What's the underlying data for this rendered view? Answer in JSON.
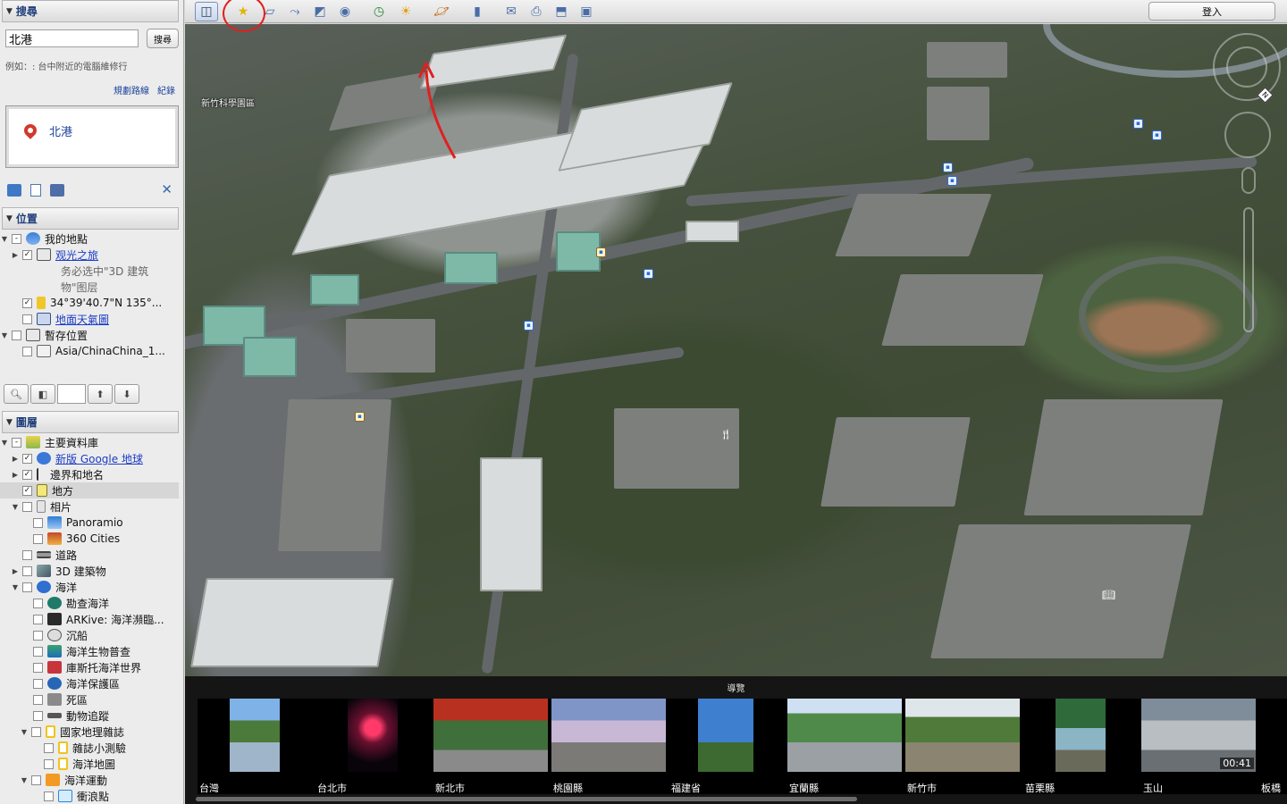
{
  "search": {
    "header": "搜尋",
    "query_value": "北港",
    "button_label": "搜尋",
    "example_text": "例如：: 台中附近的電腦維修行",
    "route_link": "規劃路線",
    "history_link": "紀錄",
    "result_label": "北港"
  },
  "places": {
    "header": "位置",
    "items": [
      {
        "label": "我的地點"
      },
      {
        "label": "观光之旅"
      },
      {
        "label": "务必选中\"3D 建筑"
      },
      {
        "label": "物\"图层"
      },
      {
        "label": "34°39'40.7\"N 135°..."
      },
      {
        "label": "地面天氣圖"
      },
      {
        "label": "暫存位置"
      },
      {
        "label": "Asia/ChinaChina_1..."
      }
    ]
  },
  "layers": {
    "header": "圖層",
    "items": [
      {
        "label": "主要資料庫"
      },
      {
        "label": "新版 Google 地球"
      },
      {
        "label": "邊界和地名"
      },
      {
        "label": "地方"
      },
      {
        "label": "相片"
      },
      {
        "label": "Panoramio"
      },
      {
        "label": "360 Cities"
      },
      {
        "label": "道路"
      },
      {
        "label": "3D 建築物"
      },
      {
        "label": "海洋"
      },
      {
        "label": "勘查海洋"
      },
      {
        "label": "ARKive: 海洋瀕臨..."
      },
      {
        "label": "沉船"
      },
      {
        "label": "海洋生物普查"
      },
      {
        "label": "庫斯托海洋世界"
      },
      {
        "label": "海洋保護區"
      },
      {
        "label": "死區"
      },
      {
        "label": "動物追蹤"
      },
      {
        "label": "國家地理雜誌"
      },
      {
        "label": "雜誌小測驗"
      },
      {
        "label": "海洋地圖"
      },
      {
        "label": "海洋運動"
      },
      {
        "label": "衝浪點"
      }
    ]
  },
  "toolbar": {
    "login_label": "登入",
    "icons": [
      "sidebar-toggle-icon",
      "add-placemark-icon",
      "add-polygon-icon",
      "add-path-icon",
      "add-image-overlay-icon",
      "record-tour-icon",
      "historical-imagery-icon",
      "sunlight-icon",
      "planets-icon",
      "ruler-icon",
      "email-icon",
      "print-icon",
      "save-image-icon",
      "view-in-maps-icon"
    ]
  },
  "map": {
    "place_label": "新竹科學園區"
  },
  "tour": {
    "title": "導覽",
    "cards": [
      {
        "label": "台灣"
      },
      {
        "label": "台北市"
      },
      {
        "label": "新北市"
      },
      {
        "label": "桃園縣"
      },
      {
        "label": "福建省"
      },
      {
        "label": "宜蘭縣"
      },
      {
        "label": "新竹市"
      },
      {
        "label": "苗栗縣"
      },
      {
        "label": "玉山"
      },
      {
        "label": "板橋"
      }
    ],
    "duration": "00:41"
  },
  "colors": {
    "accent_link": "#1b3cc7",
    "annotation_red": "#e02020",
    "header_text": "#1f3f7a"
  }
}
